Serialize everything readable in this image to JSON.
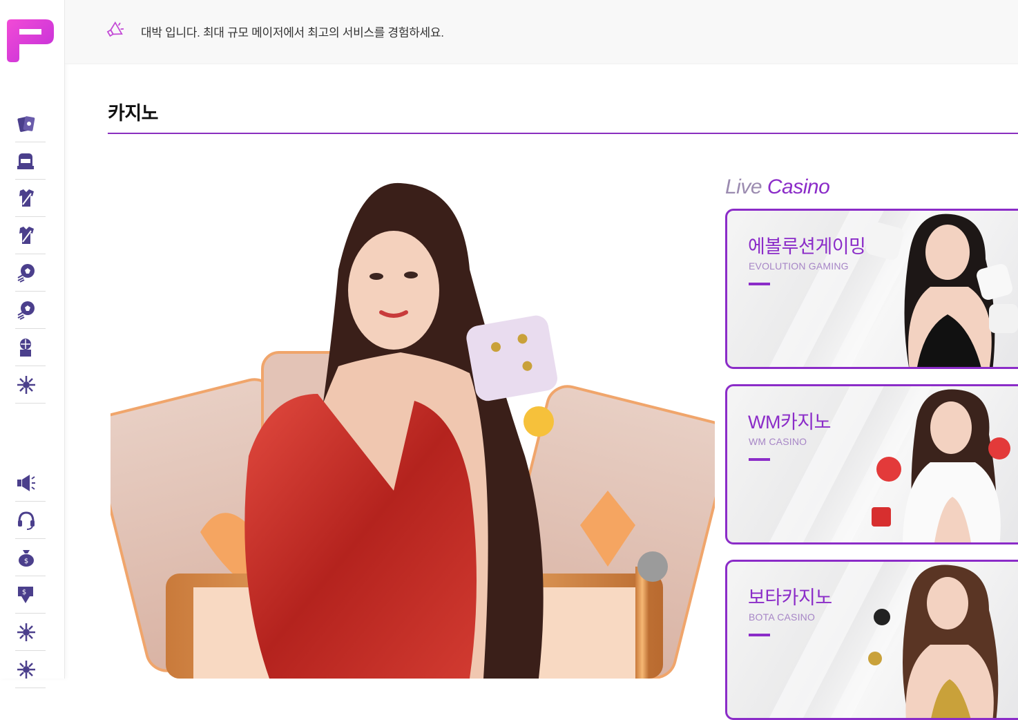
{
  "sidebar": {
    "logo_alt": "P",
    "top_items": [
      {
        "icon": "cards-icon"
      },
      {
        "icon": "slot-machine-icon"
      },
      {
        "icon": "sports-jersey-icon"
      },
      {
        "icon": "sports-jersey-icon"
      },
      {
        "icon": "soccer-ball-icon"
      },
      {
        "icon": "soccer-ball-icon"
      },
      {
        "icon": "arcade-game-icon"
      },
      {
        "icon": "star-burst-icon"
      }
    ],
    "bottom_items": [
      {
        "icon": "megaphone-icon"
      },
      {
        "icon": "headset-icon"
      },
      {
        "icon": "money-bag-icon"
      },
      {
        "icon": "withdraw-icon"
      },
      {
        "icon": "star-burst-icon"
      },
      {
        "icon": "star-burst-icon"
      }
    ]
  },
  "notice": {
    "icon": "megaphone-icon",
    "text": "대박 입니다. 최대 규모 메이저에서 최고의 서비스를 경험하세요."
  },
  "section": {
    "title": "카지노"
  },
  "live": {
    "title_part1": "Live",
    "title_part2": "Casino",
    "cards": [
      {
        "kr": "에볼루션게이밍",
        "en": "EVOLUTION GAMING"
      },
      {
        "kr": "WM카지노",
        "en": "WM CASINO"
      },
      {
        "kr": "보타카지노",
        "en": "BOTA CASINO"
      }
    ]
  },
  "colors": {
    "accent": "#8b2cc8",
    "logo_pink": "#e53ad9",
    "sidebar_icon": "#4b3f8c"
  }
}
